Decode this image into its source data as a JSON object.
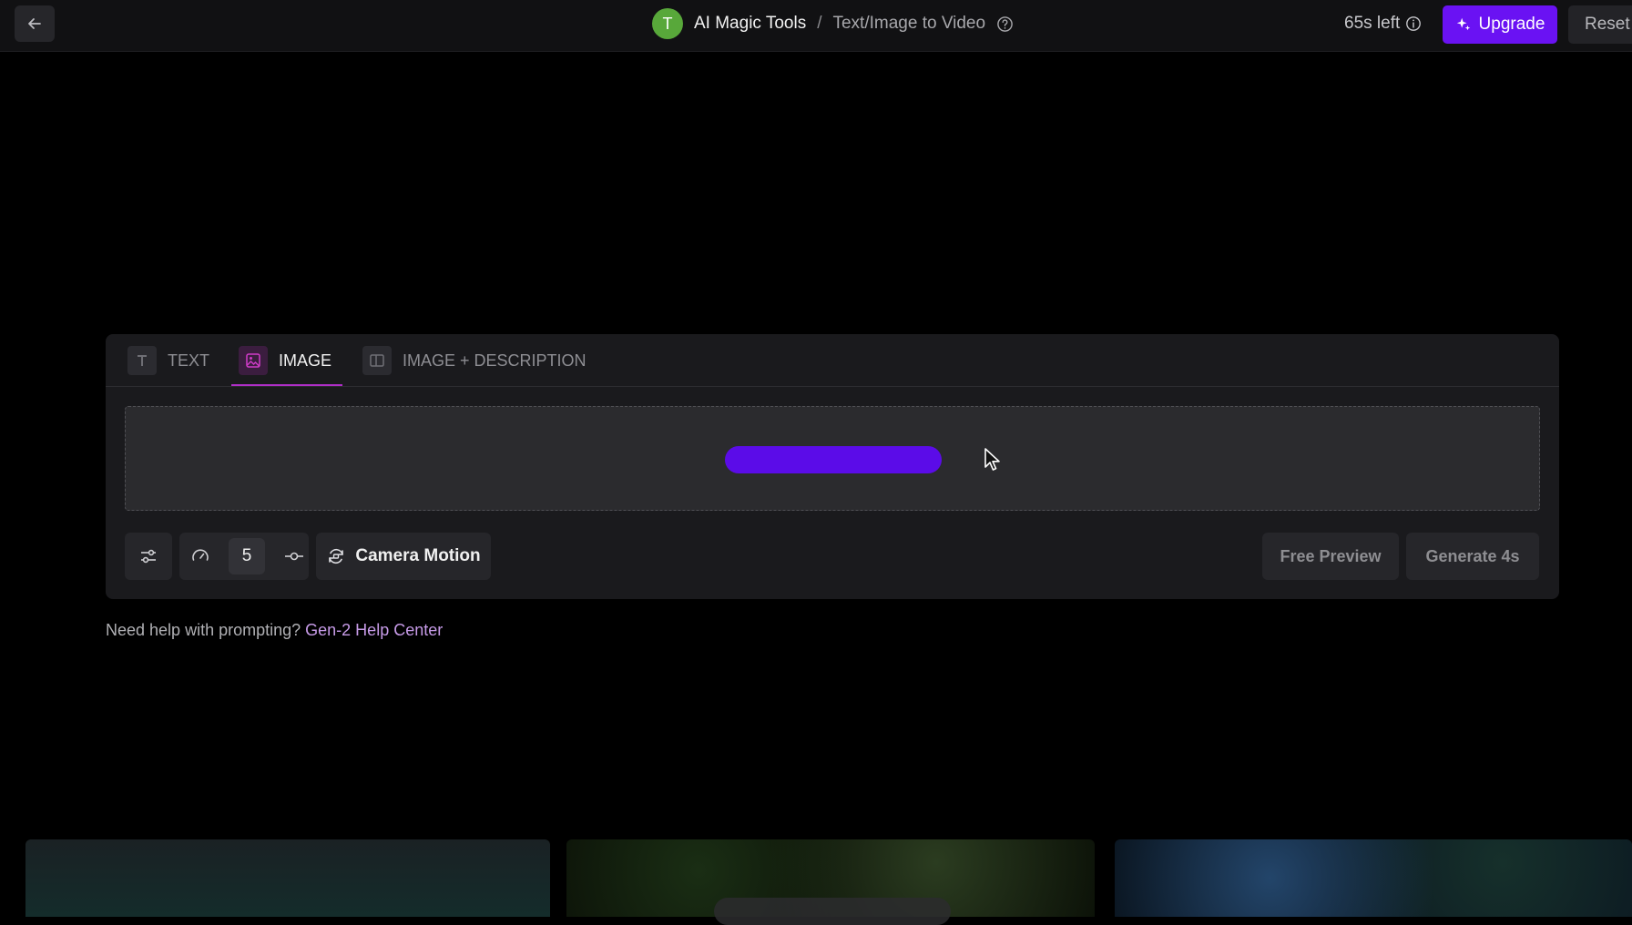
{
  "topbar": {
    "avatar_initial": "T",
    "app_name": "AI Magic Tools",
    "separator": "/",
    "page_name": "Text/Image to Video",
    "credits_left": "65s left",
    "upgrade_label": "Upgrade",
    "reset_label": "Reset"
  },
  "tabs": [
    {
      "label": "TEXT",
      "icon": "text-icon",
      "active": false
    },
    {
      "label": "IMAGE",
      "icon": "image-icon",
      "active": true
    },
    {
      "label": "IMAGE + DESCRIPTION",
      "icon": "image-description-icon",
      "active": false
    }
  ],
  "toolbar": {
    "motion_value": "5",
    "camera_motion_label": "Camera Motion",
    "free_preview_label": "Free Preview",
    "generate_label": "Generate 4s"
  },
  "help": {
    "prefix": "Need help with prompting?",
    "link": "Gen-2 Help Center"
  },
  "colors": {
    "accent": "#6a12f3",
    "active_tab_underline": "#b02ec8",
    "background": "#000000",
    "card": "#1a1a1d"
  }
}
